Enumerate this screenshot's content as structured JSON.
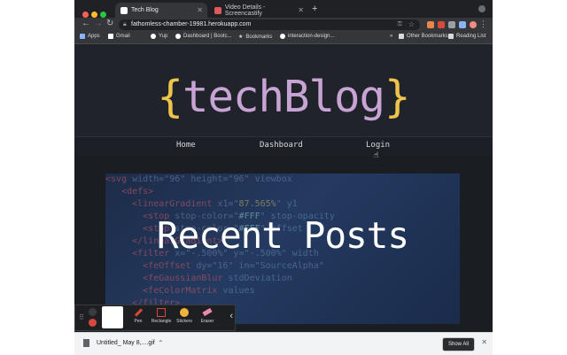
{
  "browser": {
    "tabs": [
      {
        "title": "Tech Blog",
        "active": true
      },
      {
        "title": "Video Details - Screencastify",
        "active": false
      }
    ],
    "new_tab_label": "+",
    "url": "fathomless-chamber-19981.herokuapp.com",
    "bookmarks": [
      {
        "label": "Apps"
      },
      {
        "label": "Gmail"
      },
      {
        "label": "Yup"
      },
      {
        "label": "Dashboard | Bootc..."
      },
      {
        "label": "Bookmarks"
      },
      {
        "label": "interaction-design..."
      }
    ],
    "bookmarks_overflow": "»",
    "other_bookmarks": "Other Bookmarks",
    "reading_list": "Reading List"
  },
  "page": {
    "logo": {
      "open": "{",
      "name": "techBlog",
      "close": "}"
    },
    "nav": [
      {
        "label": "Home"
      },
      {
        "label": "Dashboard"
      },
      {
        "label": "Login"
      }
    ],
    "hero_title": "Recent Posts"
  },
  "annotation_toolbar": {
    "tools": [
      {
        "label": "Pen",
        "icon": "pen-icon"
      },
      {
        "label": "Rectangle",
        "icon": "rectangle-icon"
      },
      {
        "label": "Stickers",
        "icon": "sticker-icon"
      },
      {
        "label": "Eraser",
        "icon": "eraser-icon"
      }
    ]
  },
  "downloads": {
    "file": "Untitled_ May 8,....gif",
    "show_all": "Show All"
  },
  "colors": {
    "logo_text": "#c7a4d3",
    "logo_brace": "#efc44c",
    "page_bg": "#20242a"
  }
}
